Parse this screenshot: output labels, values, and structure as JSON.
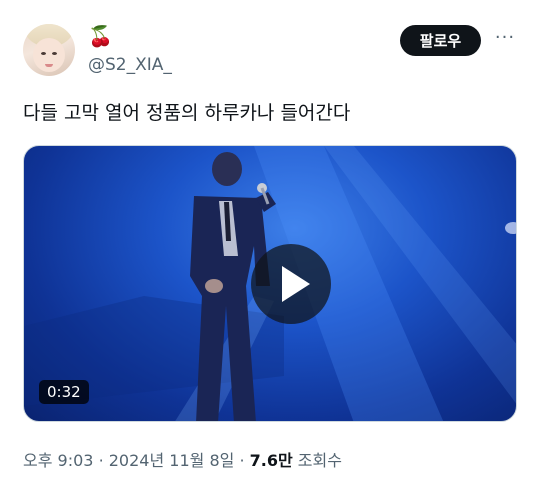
{
  "author": {
    "display_name": "🍒",
    "handle": "@S2_XIA_"
  },
  "follow_label": "팔로우",
  "more_label": "···",
  "tweet": {
    "text": "다들 고막 열어 정품의 하루카나 들어간다"
  },
  "video": {
    "duration": "0:32"
  },
  "meta": {
    "time": "오후 9:03",
    "separator": "·",
    "date": "2024년 11월 8일",
    "views_count": "7.6만",
    "views_label": "조회수"
  },
  "colors": {
    "follow_bg": "#0f1419",
    "secondary_text": "#536471",
    "video_blue": "#1c54c9"
  }
}
